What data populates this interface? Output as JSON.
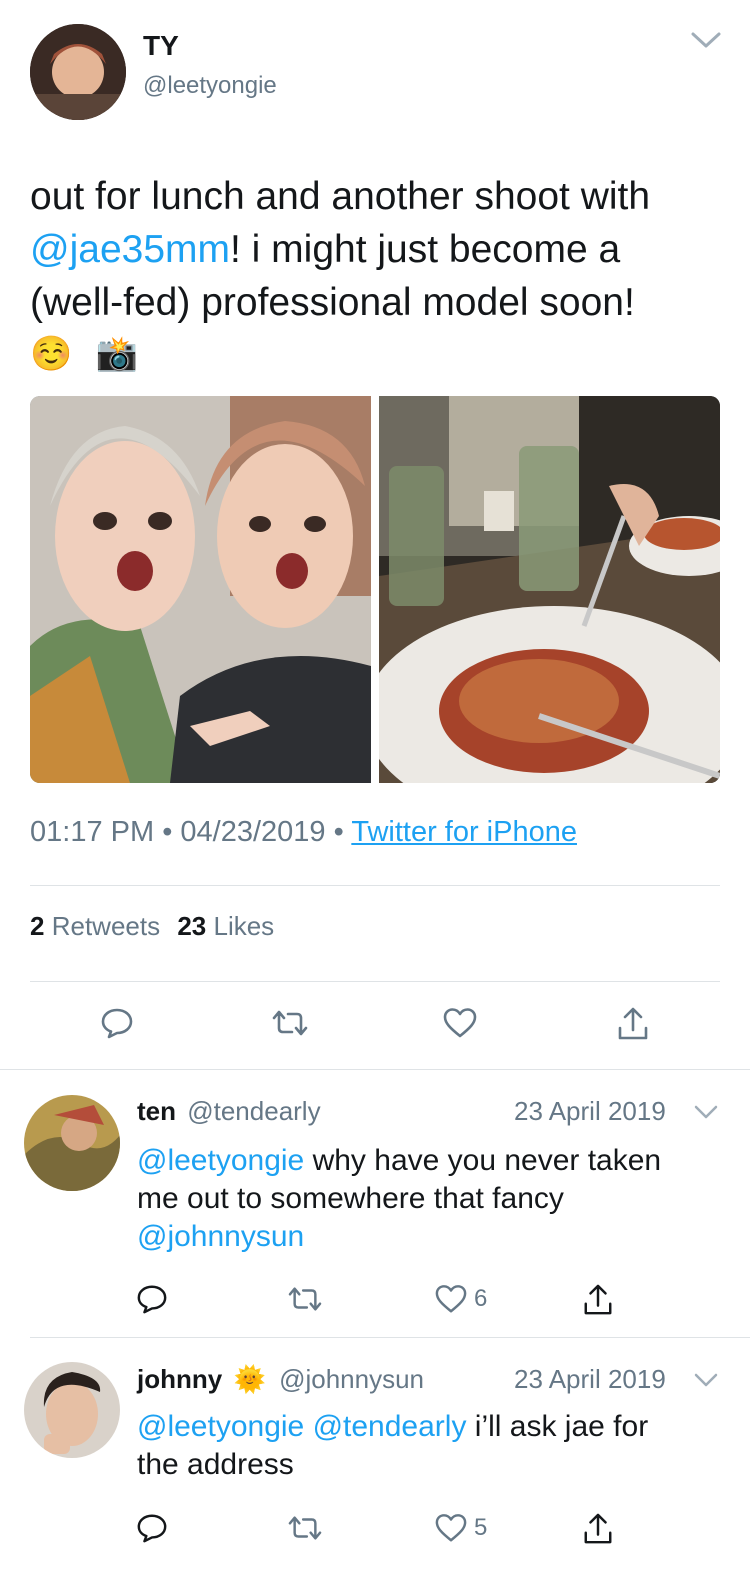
{
  "main_tweet": {
    "display_name": "TY",
    "handle": "@leetyongie",
    "text_line1": "out for lunch and another shoot with",
    "mention": "@jae35mm",
    "text_line2_rest": "! i might just become a",
    "text_line3": "(well-fed) professional model soon!",
    "emojis": [
      "☺️",
      "📸"
    ],
    "time": "01:17 PM",
    "date": "04/23/2019",
    "source": "Twitter for iPhone",
    "retweets_count": "2",
    "retweets_label": "Retweets",
    "likes_count": "23",
    "likes_label": "Likes"
  },
  "replies": [
    {
      "display_name": "ten",
      "handle": "@tendearly",
      "date": "23 April 2019",
      "mention1": "@leetyongie",
      "text_line1": " why have you never taken",
      "text_line2": "me out to somewhere that fancy",
      "mention2": "@johnnysun",
      "like_count": "6"
    },
    {
      "display_name": "johnny",
      "name_emoji": "🌞",
      "handle": "@johnnysun",
      "date": "23 April 2019",
      "mention1": "@leetyongie",
      "mention2": "@tendearly",
      "text_line1": " i’ll ask jae for",
      "text_line2": "the address",
      "like_count": "5"
    }
  ],
  "colors": {
    "link": "#1da1f2",
    "muted": "#657786",
    "divider": "#dfe3e6",
    "text": "#14171a"
  },
  "icons": [
    "chevron-down-icon",
    "reply-icon",
    "retweet-icon",
    "like-icon",
    "share-icon"
  ]
}
